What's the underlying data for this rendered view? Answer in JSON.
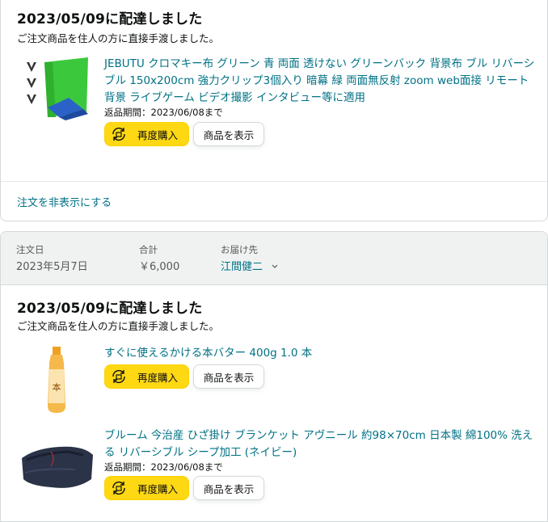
{
  "order1": {
    "delivery_title": "2023/05/09に配達しました",
    "delivery_sub": "ご注文商品を住人の方に直接手渡しました。",
    "items": [
      {
        "title": "JEBUTU クロマキー布 グリーン 青 両面 透けない グリーンバック 背景布 ブル リバーシブル 150x200cm 強力クリップ3個入り 暗幕 緑 両面無反射 zoom web面接 リモート背景 ライブゲーム ビデオ撮影 インタビュー等に適用",
        "return_period": "返品期間：2023/06/08まで",
        "rebuy_label": "再度購入",
        "view_label": "商品を表示"
      }
    ],
    "hide_label": "注文を非表示にする"
  },
  "order2": {
    "header": {
      "date_label": "注文日",
      "date_value": "2023年5月7日",
      "total_label": "合計",
      "total_value": "￥6,000",
      "ship_label": "お届け先",
      "ship_value": "江間健二"
    },
    "delivery_title": "2023/05/09に配達しました",
    "delivery_sub": "ご注文商品を住人の方に直接手渡しました。",
    "items": [
      {
        "title": "すぐに使えるかける本バター 400g 1.0 本",
        "rebuy_label": "再度購入",
        "view_label": "商品を表示"
      },
      {
        "title": "ブルーム 今治産 ひざ掛け ブランケット アヴニール 約98×70cm 日本製 綿100% 洗える リバーシブル シープ加工 (ネイビー)",
        "return_period": "返品期間：2023/06/08まで",
        "rebuy_label": "再度購入",
        "view_label": "商品を表示"
      }
    ]
  },
  "colors": {
    "link": "#007185",
    "button_yellow": "#ffd814",
    "header_bg": "#f0f2f2"
  },
  "icons": [
    "rebuy-icon",
    "chevron-down-icon"
  ]
}
